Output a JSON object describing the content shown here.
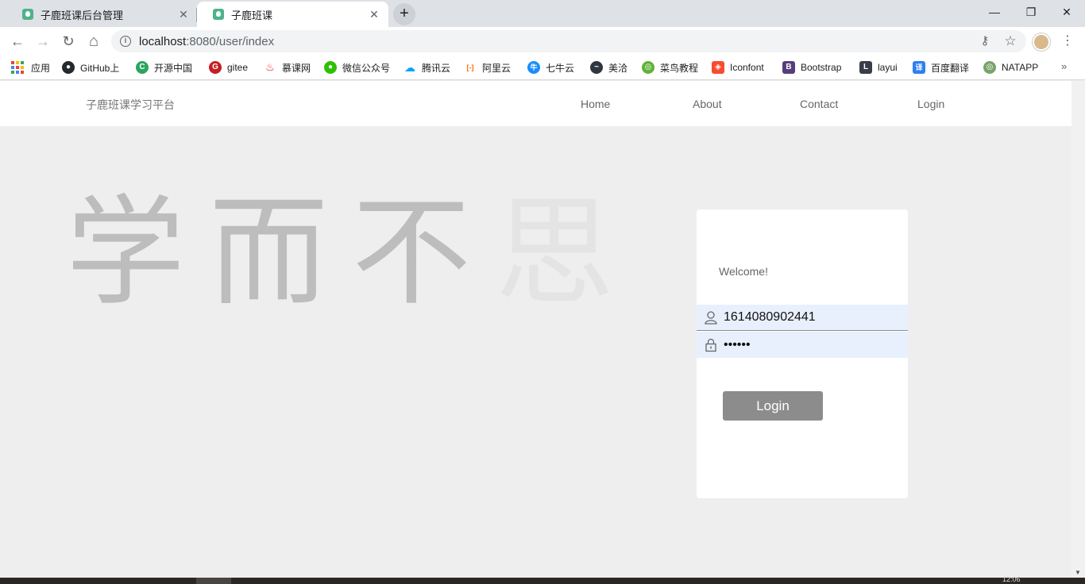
{
  "browser": {
    "tabs": [
      {
        "title": "子鹿班课后台管理",
        "close": "✕"
      },
      {
        "title": "子鹿班课",
        "close": "✕"
      }
    ],
    "new_tab": "+",
    "window_controls": {
      "minimize": "—",
      "restore": "❐",
      "close": "✕"
    },
    "nav": {
      "back": "←",
      "forward": "→",
      "reload": "↻",
      "home": "⌂"
    },
    "address": {
      "info": "i",
      "host": "localhost",
      "path": ":8080/user/index"
    },
    "omnibox_icons": {
      "key": "⚷",
      "star": "☆"
    },
    "menu": "⋮",
    "bookmarks": [
      {
        "label": "应用",
        "icon": "apps-grid-icon"
      },
      {
        "label": "GitHub上",
        "icon": "github-icon",
        "color": "#24292e",
        "glyph": "●"
      },
      {
        "label": "开源中国",
        "icon": "oschina-icon",
        "color": "#2aa55e",
        "glyph": "C"
      },
      {
        "label": "gitee",
        "icon": "gitee-icon",
        "color": "#c71d23",
        "glyph": "G"
      },
      {
        "label": "慕课网",
        "icon": "imooc-icon",
        "color": "#f01414",
        "glyph": "♨"
      },
      {
        "label": "微信公众号",
        "icon": "wechat-icon",
        "color": "#2dc100",
        "glyph": "●"
      },
      {
        "label": "腾讯云",
        "icon": "tencent-cloud-icon",
        "color": "#00a3ff",
        "glyph": "☁"
      },
      {
        "label": "阿里云",
        "icon": "aliyun-icon",
        "color": "#ff6a00",
        "glyph": "[-]"
      },
      {
        "label": "七牛云",
        "icon": "qiniu-icon",
        "color": "#1a8cff",
        "glyph": "牛"
      },
      {
        "label": "美洽",
        "icon": "meiqia-icon",
        "color": "#2f3640",
        "glyph": "~"
      },
      {
        "label": "菜鸟教程",
        "icon": "runoob-icon",
        "color": "#5fb336",
        "glyph": "◎"
      },
      {
        "label": "Iconfont",
        "icon": "iconfont-icon",
        "color": "#f74c30",
        "glyph": "◈"
      },
      {
        "label": "Bootstrap",
        "icon": "bootstrap-icon",
        "color": "#563d7c",
        "glyph": "B"
      },
      {
        "label": "layui",
        "icon": "layui-icon",
        "color": "#393d49",
        "glyph": "L"
      },
      {
        "label": "百度翻译",
        "icon": "baidu-translate-icon",
        "color": "#2f7ff0",
        "glyph": "译"
      },
      {
        "label": "NATAPP",
        "icon": "natapp-icon",
        "color": "#7aa36a",
        "glyph": "◎"
      }
    ],
    "bookmarks_more": "»"
  },
  "site": {
    "brand": "子鹿班课学习平台",
    "nav": [
      "Home",
      "About",
      "Contact",
      "Login"
    ],
    "slogan": [
      "学",
      "而",
      "不",
      "思"
    ]
  },
  "login": {
    "welcome": "Welcome!",
    "username": "1614080902441",
    "password": "••••••",
    "button": "Login"
  },
  "taskbar": {
    "clock": "12:06"
  },
  "colors": {
    "page_bg": "#eeeeee",
    "slogan": "#bdbdbd",
    "slogan_faded": "#e4e4e4",
    "autofill_bg": "#e8f0fe",
    "button_bg": "#8c8c8c"
  }
}
